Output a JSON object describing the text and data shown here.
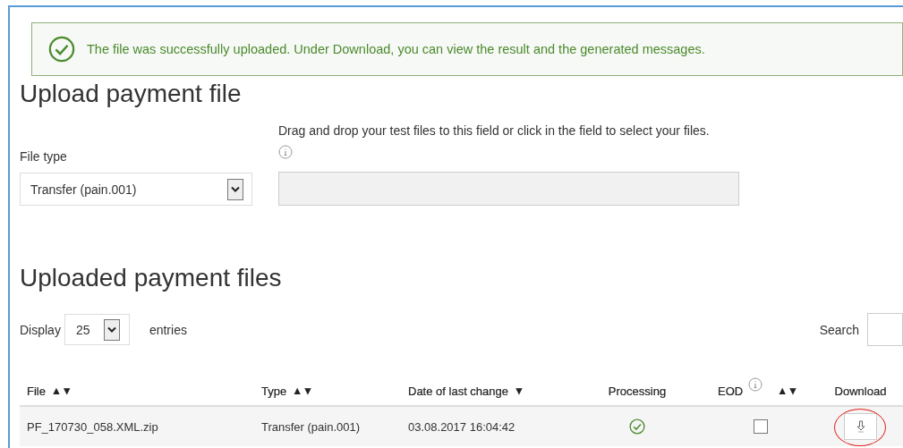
{
  "alert": {
    "kind": "success",
    "text": "The file was successfully uploaded. Under Download, you can view the result and the generated messages."
  },
  "upload": {
    "title": "Upload payment file",
    "file_type": {
      "label": "File type",
      "value": "Transfer (pain.001)"
    },
    "dropzone": {
      "hint": "Drag and drop your test files to this field or click in the field to select your files."
    }
  },
  "uploaded": {
    "title": "Uploaded payment files",
    "length": {
      "label_before": "Display",
      "value": "25",
      "label_after": "entries"
    },
    "search": {
      "label": "Search"
    },
    "table": {
      "columns": [
        {
          "label": "File",
          "sort": "▲▼"
        },
        {
          "label": "Type",
          "sort": "▲▼"
        },
        {
          "label": "Date of last change",
          "sort": "▼"
        },
        {
          "label": "Processing"
        },
        {
          "label": "EOD",
          "sort": "▲▼",
          "info": true
        },
        {
          "label": "Download"
        }
      ],
      "rows": [
        {
          "file": "PF_170730_058.XML.zip",
          "type": "Transfer (pain.001)",
          "date": "03.08.2017 16:04:42",
          "processed": true,
          "eod": false,
          "download_highlighted": true
        }
      ]
    }
  }
}
